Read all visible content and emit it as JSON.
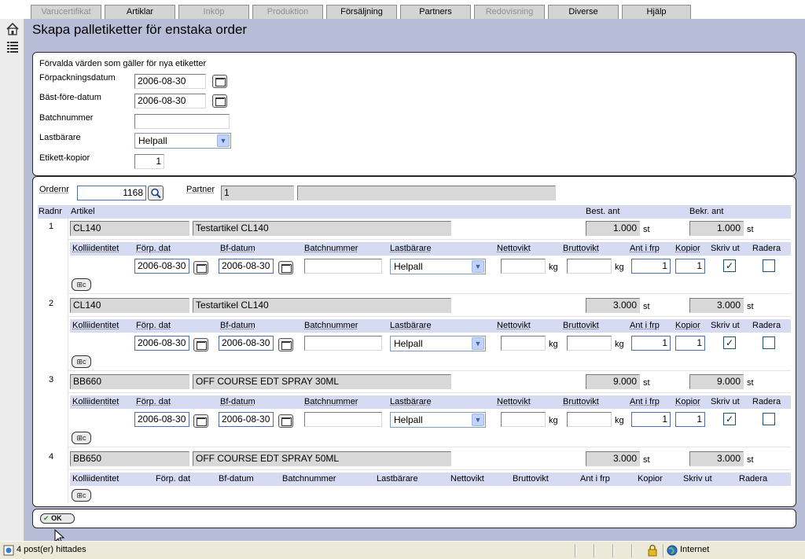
{
  "nav_tabs": [
    {
      "label": "Varucertifikat",
      "enabled": false
    },
    {
      "label": "Artiklar",
      "enabled": true
    },
    {
      "label": "Inköp",
      "enabled": false
    },
    {
      "label": "Produktion",
      "enabled": false
    },
    {
      "label": "Försäljning",
      "enabled": true
    },
    {
      "label": "Partners",
      "enabled": true
    },
    {
      "label": "Redovisning",
      "enabled": false
    },
    {
      "label": "Diverse",
      "enabled": true
    },
    {
      "label": "Hjälp",
      "enabled": true
    }
  ],
  "left_icons": [
    "home-icon",
    "list-icon"
  ],
  "page_title": "Skapa palletiketter för enstaka order",
  "defaults": {
    "heading": "Förvalda värden som gäller för nya etiketter",
    "packing_date_label": "Förpackningsdatum",
    "packing_date": "2006-08-30",
    "best_before_label": "Bäst-före-datum",
    "best_before": "2006-08-30",
    "batch_label": "Batchnummer",
    "batch": "",
    "carrier_label": "Lastbärare",
    "carrier": "Helpall",
    "copies_label": "Etikett-kopior",
    "copies": "1"
  },
  "order": {
    "ordernr_label": "Ordernr",
    "ordernr": "1168",
    "partner_label": "Partner",
    "partner_id": "1",
    "partner_name": ""
  },
  "table": {
    "headers": {
      "row": "Radnr",
      "article": "Artikel",
      "ordered": "Best. ant",
      "confirmed": "Bekr. ant"
    },
    "sub_headers": {
      "colli": "Kolliidentitet",
      "pack_date": "Förp. dat",
      "bf_date": "Bf-datum",
      "batch": "Batchnummer",
      "carrier": "Lastbärare",
      "net": "Nettovikt",
      "gross": "Bruttovikt",
      "qty": "Ant i frp",
      "copies": "Kopior",
      "print": "Skriv ut",
      "delete": "Radera"
    },
    "unit_st": "st",
    "unit_kg": "kg",
    "rows": [
      {
        "nr": "1",
        "code": "CL140",
        "name": "Testartikel CL140",
        "ordered": "1.000",
        "confirmed": "1.000",
        "pack_date": "2006-08-30",
        "bf_date": "2006-08-30",
        "batch": "",
        "carrier": "Helpall",
        "net": "",
        "gross": "",
        "qty": "1",
        "copies": "1",
        "print": "✓",
        "delete": ""
      },
      {
        "nr": "2",
        "code": "CL140",
        "name": "Testartikel CL140",
        "ordered": "3.000",
        "confirmed": "3.000",
        "pack_date": "2006-08-30",
        "bf_date": "2006-08-30",
        "batch": "",
        "carrier": "Helpall",
        "net": "",
        "gross": "",
        "qty": "1",
        "copies": "1",
        "print": "✓",
        "delete": ""
      },
      {
        "nr": "3",
        "code": "BB660",
        "name": "OFF COURSE EDT SPRAY 30ML",
        "ordered": "9.000",
        "confirmed": "9.000",
        "pack_date": "2006-08-30",
        "bf_date": "2006-08-30",
        "batch": "",
        "carrier": "Helpall",
        "net": "",
        "gross": "",
        "qty": "1",
        "copies": "1",
        "print": "✓",
        "delete": ""
      },
      {
        "nr": "4",
        "code": "BB650",
        "name": "OFF COURSE EDT SPRAY 50ML",
        "ordered": "3.000",
        "confirmed": "3.000"
      }
    ]
  },
  "ok_label": "OK",
  "status": {
    "text": "4 post(er) hittades",
    "zone": "Internet"
  }
}
